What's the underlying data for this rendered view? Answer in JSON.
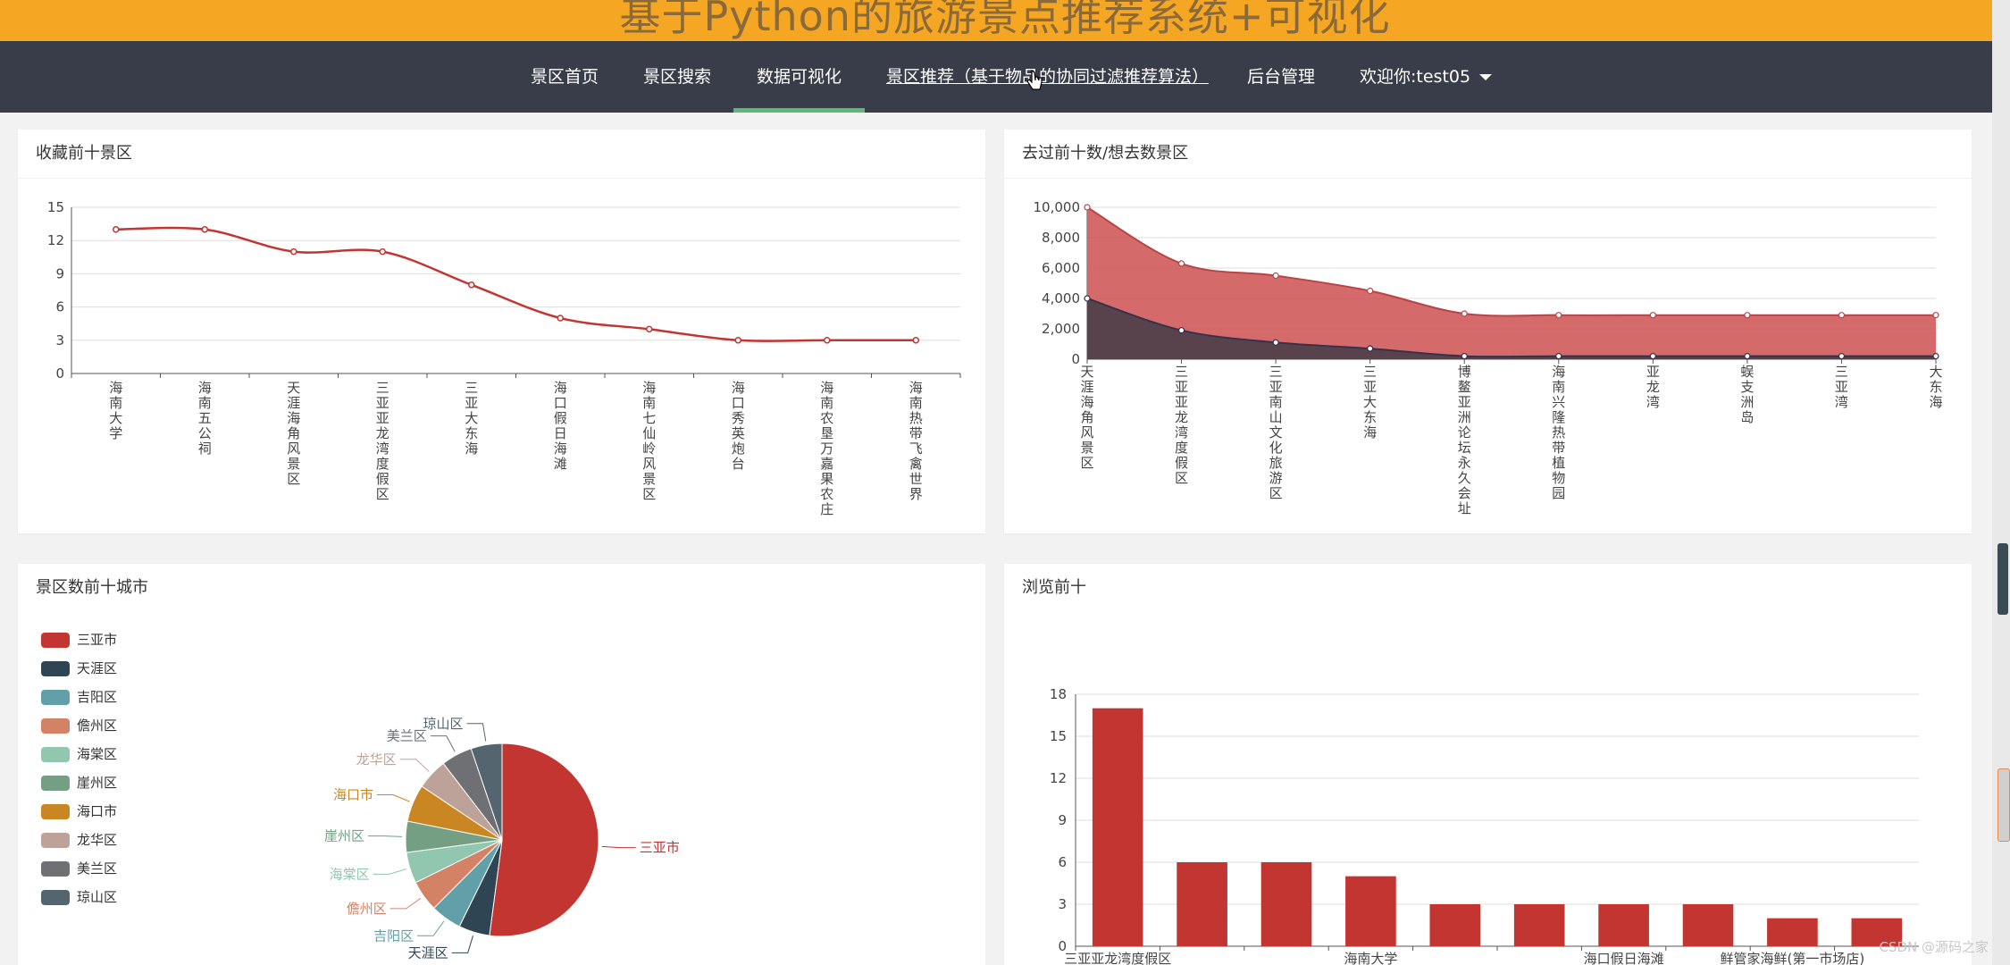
{
  "app_title": "基于Python的旅游景点推荐系统+可视化",
  "nav": {
    "items": [
      "景区首页",
      "景区搜索",
      "数据可视化",
      "景区推荐（基于物品的协同过滤推荐算法）",
      "后台管理"
    ],
    "user": "欢迎你:test05",
    "active_index": 2
  },
  "panels": {
    "favorites_title": "收藏前十景区",
    "visits_title": "去过前十数/想去数景区",
    "city_title": "景区数前十城市",
    "browse_title": "浏览前十"
  },
  "colors": {
    "nav_bg": "#393d49",
    "banner_bg": "#f5a623",
    "accent": "#5fb878",
    "red": "#c23531"
  },
  "watermark": "CSDN @源码之家",
  "chart_data": [
    {
      "type": "line",
      "title": "收藏前十景区",
      "categories": [
        "海南大学",
        "海南五公祠",
        "天涯海角风景区",
        "三亚亚龙湾度假区",
        "三亚大东海",
        "海口假日海滩",
        "海南七仙岭风景区",
        "海口秀英炮台",
        "海南农垦万嘉果农庄",
        "海南热带飞禽世界"
      ],
      "values": [
        13,
        13,
        11,
        11,
        8,
        5,
        4,
        3,
        3,
        3
      ],
      "ylim": [
        0,
        15
      ],
      "yticks": [
        "0",
        "3",
        "6",
        "9",
        "12",
        "15"
      ],
      "grid": true
    },
    {
      "type": "area",
      "title": "去过前十数/想去数景区",
      "categories": [
        "天涯海角风景区",
        "三亚亚龙湾度假区",
        "三亚南山文化旅游区",
        "三亚大东海",
        "博鳌亚洲论坛永久会址",
        "海南兴隆热带植物园",
        "亚龙湾",
        "蜈支洲岛",
        "三亚湾",
        "大东海"
      ],
      "series": [
        {
          "values": [
            10000,
            6300,
            5500,
            4500,
            3000,
            2900,
            2900,
            2900,
            2900,
            2900
          ]
        },
        {
          "values": [
            4000,
            1900,
            1100,
            700,
            200,
            200,
            200,
            200,
            200,
            200
          ]
        }
      ],
      "ylim": [
        0,
        10000
      ],
      "yticks": [
        "0",
        "2,000",
        "4,000",
        "6,000",
        "8,000",
        "10,000"
      ],
      "grid": true
    },
    {
      "type": "pie",
      "title": "景区数前十城市",
      "legend": "left",
      "slices": [
        {
          "name": "三亚市",
          "value": 50,
          "color": "#c23531"
        },
        {
          "name": "天涯区",
          "value": 5,
          "color": "#2f4554"
        },
        {
          "name": "吉阳区",
          "value": 5,
          "color": "#61a0a8"
        },
        {
          "name": "儋州区",
          "value": 5,
          "color": "#d48265"
        },
        {
          "name": "海棠区",
          "value": 5,
          "color": "#91c7ae"
        },
        {
          "name": "崖州区",
          "value": 5,
          "color": "#749f83"
        },
        {
          "name": "海口市",
          "value": 6,
          "color": "#ca8622"
        },
        {
          "name": "龙华区",
          "value": 5,
          "color": "#bda29a"
        },
        {
          "name": "美兰区",
          "value": 5,
          "color": "#6e7074"
        },
        {
          "name": "琼山区",
          "value": 5,
          "color": "#546570"
        }
      ]
    },
    {
      "type": "bar",
      "title": "浏览前十",
      "categories": [
        "三亚亚龙湾度假区",
        "",
        "",
        "海南大学",
        "",
        "",
        "海口假日海滩",
        "",
        "鲜管家海鲜(第一市场店)",
        ""
      ],
      "values": [
        17,
        6,
        6,
        5,
        3,
        3,
        3,
        3,
        2,
        2
      ],
      "ylim": [
        0,
        18
      ],
      "yticks": [
        "0",
        "3",
        "6",
        "9",
        "12",
        "15",
        "18"
      ],
      "grid": true
    }
  ]
}
